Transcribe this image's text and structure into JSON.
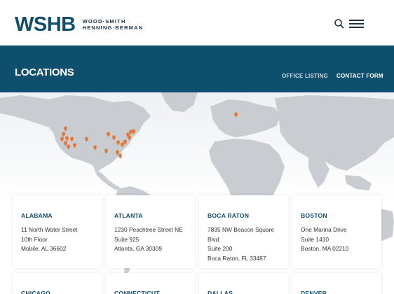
{
  "header": {
    "logo_mark": "WSHB",
    "logo_line1": "WOOD·SMITH",
    "logo_line2": "HENNING·BERMAN"
  },
  "banner": {
    "title": "LOCATIONS",
    "links": [
      "OFFICE LISTING",
      "CONTACT FORM"
    ]
  },
  "colors": {
    "brand": "#0f4f6e",
    "pin": "#e07a3a",
    "land": "#c9cdd1"
  },
  "locations": [
    {
      "name": "ALABAMA",
      "lines": [
        "11 North Water Street",
        "10th Floor",
        "Mobile, AL 36602"
      ]
    },
    {
      "name": "ATLANTA",
      "lines": [
        "1230 Peachtree Street NE",
        "Suite 925",
        "Atlanta, GA 30309"
      ]
    },
    {
      "name": "BOCA RATON",
      "lines": [
        "7835 NW Beacon Square",
        "Blvd.",
        "Suite 200",
        "Boca Raton, FL 33487"
      ]
    },
    {
      "name": "BOSTON",
      "lines": [
        "One Marina Drive",
        "Suite 1410",
        "Boston, MA 02210"
      ]
    },
    {
      "name": "CHICAGO",
      "lines": []
    },
    {
      "name": "CONNECTICUT",
      "lines": []
    },
    {
      "name": "DALLAS",
      "lines": []
    },
    {
      "name": "DENVER",
      "lines": []
    }
  ],
  "icons": {
    "search": "search-icon",
    "menu": "hamburger-menu-icon",
    "pin": "map-pin-icon"
  }
}
